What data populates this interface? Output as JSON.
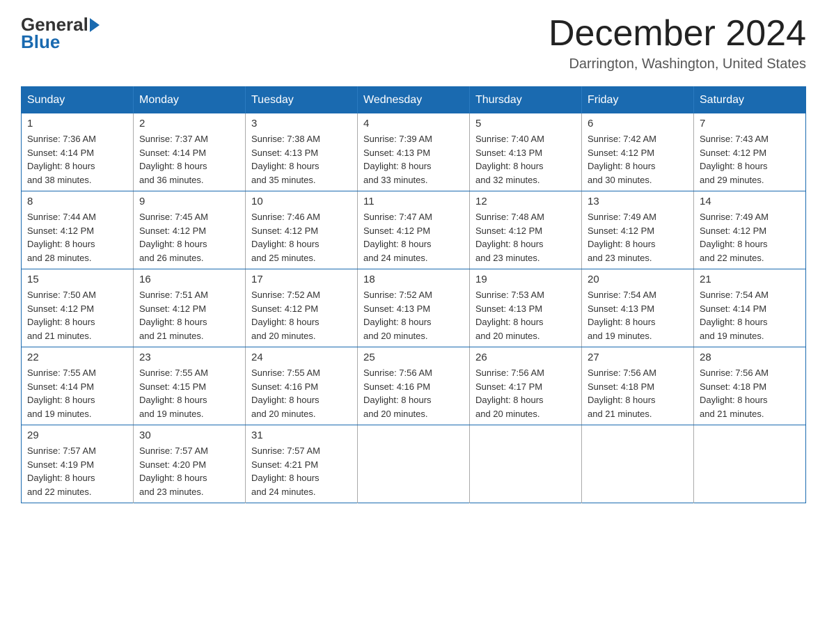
{
  "header": {
    "logo_general": "General",
    "logo_blue": "Blue",
    "month_title": "December 2024",
    "location": "Darrington, Washington, United States"
  },
  "weekdays": [
    "Sunday",
    "Monday",
    "Tuesday",
    "Wednesday",
    "Thursday",
    "Friday",
    "Saturday"
  ],
  "weeks": [
    [
      {
        "day": "1",
        "sunrise": "7:36 AM",
        "sunset": "4:14 PM",
        "daylight": "8 hours and 38 minutes."
      },
      {
        "day": "2",
        "sunrise": "7:37 AM",
        "sunset": "4:14 PM",
        "daylight": "8 hours and 36 minutes."
      },
      {
        "day": "3",
        "sunrise": "7:38 AM",
        "sunset": "4:13 PM",
        "daylight": "8 hours and 35 minutes."
      },
      {
        "day": "4",
        "sunrise": "7:39 AM",
        "sunset": "4:13 PM",
        "daylight": "8 hours and 33 minutes."
      },
      {
        "day": "5",
        "sunrise": "7:40 AM",
        "sunset": "4:13 PM",
        "daylight": "8 hours and 32 minutes."
      },
      {
        "day": "6",
        "sunrise": "7:42 AM",
        "sunset": "4:12 PM",
        "daylight": "8 hours and 30 minutes."
      },
      {
        "day": "7",
        "sunrise": "7:43 AM",
        "sunset": "4:12 PM",
        "daylight": "8 hours and 29 minutes."
      }
    ],
    [
      {
        "day": "8",
        "sunrise": "7:44 AM",
        "sunset": "4:12 PM",
        "daylight": "8 hours and 28 minutes."
      },
      {
        "day": "9",
        "sunrise": "7:45 AM",
        "sunset": "4:12 PM",
        "daylight": "8 hours and 26 minutes."
      },
      {
        "day": "10",
        "sunrise": "7:46 AM",
        "sunset": "4:12 PM",
        "daylight": "8 hours and 25 minutes."
      },
      {
        "day": "11",
        "sunrise": "7:47 AM",
        "sunset": "4:12 PM",
        "daylight": "8 hours and 24 minutes."
      },
      {
        "day": "12",
        "sunrise": "7:48 AM",
        "sunset": "4:12 PM",
        "daylight": "8 hours and 23 minutes."
      },
      {
        "day": "13",
        "sunrise": "7:49 AM",
        "sunset": "4:12 PM",
        "daylight": "8 hours and 23 minutes."
      },
      {
        "day": "14",
        "sunrise": "7:49 AM",
        "sunset": "4:12 PM",
        "daylight": "8 hours and 22 minutes."
      }
    ],
    [
      {
        "day": "15",
        "sunrise": "7:50 AM",
        "sunset": "4:12 PM",
        "daylight": "8 hours and 21 minutes."
      },
      {
        "day": "16",
        "sunrise": "7:51 AM",
        "sunset": "4:12 PM",
        "daylight": "8 hours and 21 minutes."
      },
      {
        "day": "17",
        "sunrise": "7:52 AM",
        "sunset": "4:12 PM",
        "daylight": "8 hours and 20 minutes."
      },
      {
        "day": "18",
        "sunrise": "7:52 AM",
        "sunset": "4:13 PM",
        "daylight": "8 hours and 20 minutes."
      },
      {
        "day": "19",
        "sunrise": "7:53 AM",
        "sunset": "4:13 PM",
        "daylight": "8 hours and 20 minutes."
      },
      {
        "day": "20",
        "sunrise": "7:54 AM",
        "sunset": "4:13 PM",
        "daylight": "8 hours and 19 minutes."
      },
      {
        "day": "21",
        "sunrise": "7:54 AM",
        "sunset": "4:14 PM",
        "daylight": "8 hours and 19 minutes."
      }
    ],
    [
      {
        "day": "22",
        "sunrise": "7:55 AM",
        "sunset": "4:14 PM",
        "daylight": "8 hours and 19 minutes."
      },
      {
        "day": "23",
        "sunrise": "7:55 AM",
        "sunset": "4:15 PM",
        "daylight": "8 hours and 19 minutes."
      },
      {
        "day": "24",
        "sunrise": "7:55 AM",
        "sunset": "4:16 PM",
        "daylight": "8 hours and 20 minutes."
      },
      {
        "day": "25",
        "sunrise": "7:56 AM",
        "sunset": "4:16 PM",
        "daylight": "8 hours and 20 minutes."
      },
      {
        "day": "26",
        "sunrise": "7:56 AM",
        "sunset": "4:17 PM",
        "daylight": "8 hours and 20 minutes."
      },
      {
        "day": "27",
        "sunrise": "7:56 AM",
        "sunset": "4:18 PM",
        "daylight": "8 hours and 21 minutes."
      },
      {
        "day": "28",
        "sunrise": "7:56 AM",
        "sunset": "4:18 PM",
        "daylight": "8 hours and 21 minutes."
      }
    ],
    [
      {
        "day": "29",
        "sunrise": "7:57 AM",
        "sunset": "4:19 PM",
        "daylight": "8 hours and 22 minutes."
      },
      {
        "day": "30",
        "sunrise": "7:57 AM",
        "sunset": "4:20 PM",
        "daylight": "8 hours and 23 minutes."
      },
      {
        "day": "31",
        "sunrise": "7:57 AM",
        "sunset": "4:21 PM",
        "daylight": "8 hours and 24 minutes."
      },
      null,
      null,
      null,
      null
    ]
  ],
  "labels": {
    "sunrise": "Sunrise:",
    "sunset": "Sunset:",
    "daylight": "Daylight:"
  }
}
